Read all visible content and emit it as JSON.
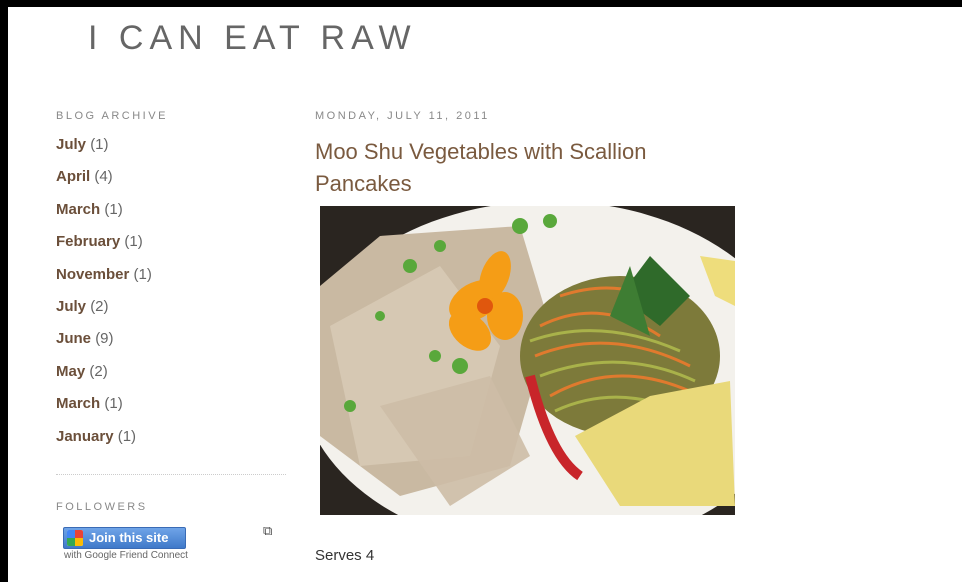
{
  "blog": {
    "title": "I CAN EAT RAW"
  },
  "sidebar": {
    "archive_heading": "BLOG ARCHIVE",
    "archive": [
      {
        "month": "July",
        "count": "(1)"
      },
      {
        "month": "April",
        "count": "(4)"
      },
      {
        "month": "March",
        "count": "(1)"
      },
      {
        "month": "February",
        "count": "(1)"
      },
      {
        "month": "November",
        "count": "(1)"
      },
      {
        "month": "July",
        "count": "(2)"
      },
      {
        "month": "June",
        "count": "(9)"
      },
      {
        "month": "May",
        "count": "(2)"
      },
      {
        "month": "March",
        "count": "(1)"
      },
      {
        "month": "January",
        "count": "(1)"
      }
    ],
    "followers_heading": "FOLLOWERS",
    "join_label": "Join this site",
    "gfc_note": "with Google Friend Connect",
    "expand_icon": "external-window-icon"
  },
  "post": {
    "date": "MONDAY, JULY 11, 2011",
    "title": "Moo Shu Vegetables with Scallion Pancakes",
    "serves": "Serves 4"
  },
  "colors": {
    "link": "#6b4f3a",
    "title": "#7a5a3f",
    "muted": "#888888"
  }
}
